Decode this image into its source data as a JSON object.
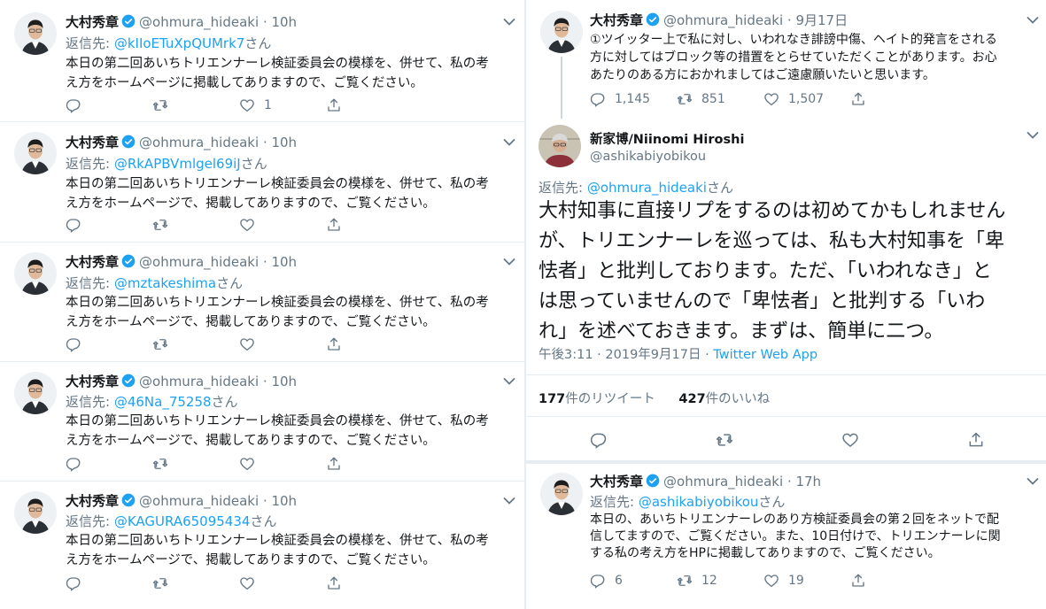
{
  "colors": {
    "accent": "#1da1f2",
    "muted": "#657786",
    "text": "#14171a",
    "border": "#e6ecf0",
    "verified": "#1da1f2"
  },
  "icons": [
    "reply-icon",
    "retweet-icon",
    "like-icon",
    "share-icon",
    "verified-icon",
    "chevron-down-icon"
  ],
  "left_tweets": [
    {
      "name": "大村秀章",
      "handle": "@ohmura_hideaki",
      "time": "· 10h",
      "reply_prefix": "返信先: ",
      "reply_to": "@kIIoETuXpQUMrk7",
      "reply_suffix": "さん",
      "lines": [
        "本日の第二回あいちトリエンナーレ検証委員会の模様を、併せて、私の考",
        "え方をホームページに掲載してありますので、ご覧ください。"
      ],
      "replies": "",
      "retweets": "",
      "likes": "1"
    },
    {
      "name": "大村秀章",
      "handle": "@ohmura_hideaki",
      "time": "· 10h",
      "reply_prefix": "返信先: ",
      "reply_to": "@RkAPBVmlgel69iJ",
      "reply_suffix": "さん",
      "lines": [
        "本日の第二回あいちトリエンナーレ検証委員会の模様を、併せて、私の考",
        "え方をホームページで、掲載してありますので、ご覧ください。"
      ],
      "replies": "",
      "retweets": "",
      "likes": ""
    },
    {
      "name": "大村秀章",
      "handle": "@ohmura_hideaki",
      "time": "· 10h",
      "reply_prefix": "返信先: ",
      "reply_to": "@mztakeshima",
      "reply_suffix": "さん",
      "lines": [
        "本日の第二回あいちトリエンナーレ検証委員会の模様を、併せて、私の考",
        "え方をホームページで、掲載してありますので、ご覧ください。"
      ],
      "replies": "",
      "retweets": "",
      "likes": ""
    },
    {
      "name": "大村秀章",
      "handle": "@ohmura_hideaki",
      "time": "· 10h",
      "reply_prefix": "返信先: ",
      "reply_to": "@46Na_75258",
      "reply_suffix": "さん",
      "lines": [
        "本日の第二回あいちトリエンナーレ検証委員会の模様を、併せて、私の考",
        "え方をホームページで、掲載してありますので、ご覧ください。"
      ],
      "replies": "",
      "retweets": "",
      "likes": ""
    },
    {
      "name": "大村秀章",
      "handle": "@ohmura_hideaki",
      "time": "· 10h",
      "reply_prefix": "返信先: ",
      "reply_to": "@KAGURA65095434",
      "reply_suffix": "さん",
      "lines": [
        "本日の第二回あいちトリエンナーレ検証委員会の模様を、併せて、私の考",
        "え方をホームページで、掲載してありますので、ご覧ください。"
      ],
      "replies": "",
      "retweets": "",
      "likes": ""
    }
  ],
  "right_top": {
    "name": "大村秀章",
    "handle": "@ohmura_hideaki",
    "time": "· 9月17日",
    "lines": [
      "①ツイッター上で私に対し、いわれなき誹謗中傷、ヘイト的発言をされる",
      "方に対してはブロック等の措置をとらせていただくことがあります。お心",
      "あたりのある方におかれましてはご遠慮願いたいと思います。"
    ],
    "replies": "1,145",
    "retweets": "851",
    "likes": "1,507"
  },
  "focus": {
    "name": "新家博/Niinomi Hiroshi",
    "handle": "@ashikabiyobikou",
    "reply_prefix": "返信先: ",
    "reply_to": "@ohmura_hideaki",
    "reply_suffix": "さん",
    "lines": [
      "大村知事に直接リプをするのは初めてかもしれません",
      "が、トリエンナーレを巡っては、私も大村知事を「卑",
      "怯者」と批判しております。ただ、「いわれなき」と",
      "は思っていませんので「卑怯者」と批判する「いわ",
      "れ」を述べておきます。まずは、簡単に二つ。"
    ],
    "time": "午後3:11 · 2019年9月17日 · ",
    "app": "Twitter Web App",
    "retweet_count": "177",
    "retweet_label": "件のリツイート",
    "like_count": "427",
    "like_label": "件のいいね"
  },
  "right_bottom": {
    "name": "大村秀章",
    "handle": "@ohmura_hideaki",
    "time": "· 17h",
    "reply_prefix": "返信先: ",
    "reply_to": "@ashikabiyobikou",
    "reply_suffix": "さん",
    "lines": [
      "本日の、あいちトリエンナーレのあり方検証委員会の第２回をネットで配",
      "信してますので、ご覧ください。また、10日付けで、トリエンナーレに関",
      "する私の考え方をHPに掲載してありますので、ご覧ください。"
    ],
    "replies": "6",
    "retweets": "12",
    "likes": "19"
  }
}
